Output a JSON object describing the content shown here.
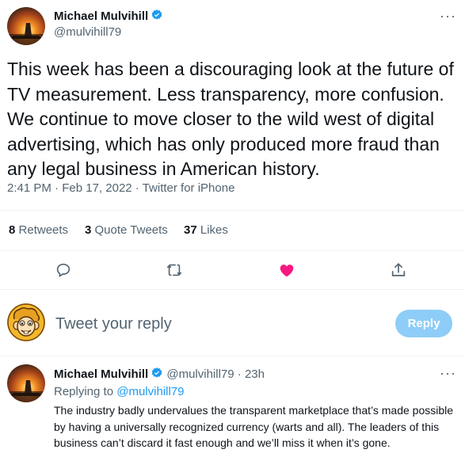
{
  "main_tweet": {
    "author_name": "Michael Mulvihill",
    "author_handle": "@mulvihill79",
    "text": "This week has been a discouraging look at the future of TV measurement. Less transparency, more confusion. We continue to move closer to the wild west of digital advertising, which has only produced more fraud than any legal business in American history.",
    "time": "2:41 PM",
    "date": "Feb 17, 2022",
    "source": "Twitter for iPhone",
    "separator": "·",
    "more_label": "···"
  },
  "stats": {
    "retweets_count": "8",
    "retweets_label": "Retweets",
    "quotes_count": "3",
    "quotes_label": "Quote Tweets",
    "likes_count": "37",
    "likes_label": "Likes"
  },
  "actions": {
    "icons": [
      "reply-icon",
      "retweet-icon",
      "like-icon",
      "share-icon"
    ],
    "liked": true,
    "like_color": "#f91880"
  },
  "compose": {
    "placeholder": "Tweet your reply",
    "button_label": "Reply",
    "button_color": "#8ecdf8"
  },
  "reply_tweet": {
    "author_name": "Michael Mulvihill",
    "author_handle": "@mulvihill79",
    "separator": "·",
    "age": "23h",
    "replying_prefix": "Replying to",
    "replying_to": "@mulvihill79",
    "text": "The industry badly undervalues the transparent marketplace that’s made possible by having a universally recognized currency (warts and all). The leaders of this business can’t discard it fast enough and we’ll miss it when it’s gone.",
    "more_label": "···"
  },
  "colors": {
    "accent": "#1d9bf0",
    "secondary_text": "#536471",
    "divider": "#eff3f4"
  }
}
